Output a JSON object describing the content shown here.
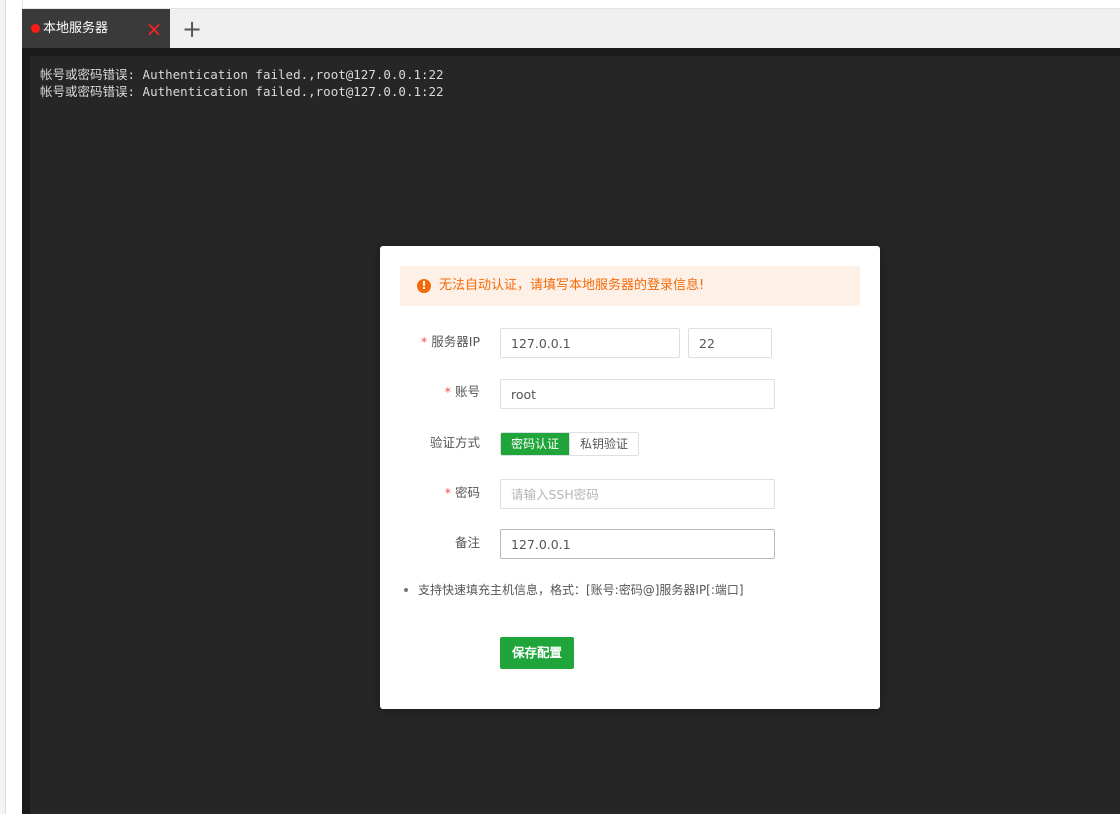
{
  "tabs": [
    {
      "title": "本地服务器",
      "status_color": "#ff1a1a",
      "close_icon": "×"
    }
  ],
  "add_tab_icon": "+",
  "terminal": {
    "lines": [
      "帐号或密码错误: Authentication failed.,root@127.0.0.1:22",
      "帐号或密码错误: Authentication failed.,root@127.0.0.1:22"
    ]
  },
  "dialog": {
    "alert": {
      "icon": "!",
      "text": "无法自动认证，请填写本地服务器的登录信息!",
      "color": "#f46b0a"
    },
    "fields": {
      "server_ip": {
        "label": "服务器IP",
        "value": "127.0.0.1",
        "port": "22",
        "required": "*"
      },
      "account": {
        "label": "账号",
        "value": "root",
        "required": "*"
      },
      "auth_method": {
        "label": "验证方式",
        "options": [
          "密码认证",
          "私钥验证"
        ],
        "selected": "密码认证"
      },
      "password": {
        "label": "密码",
        "placeholder": "请输入SSH密码",
        "value": "",
        "required": "*"
      },
      "remark": {
        "label": "备注",
        "value": "127.0.0.1"
      }
    },
    "tip": "支持快速填充主机信息，格式：[账号:密码@]服务器IP[:端口]",
    "save_label": "保存配置",
    "accent_color": "#20a53a"
  }
}
